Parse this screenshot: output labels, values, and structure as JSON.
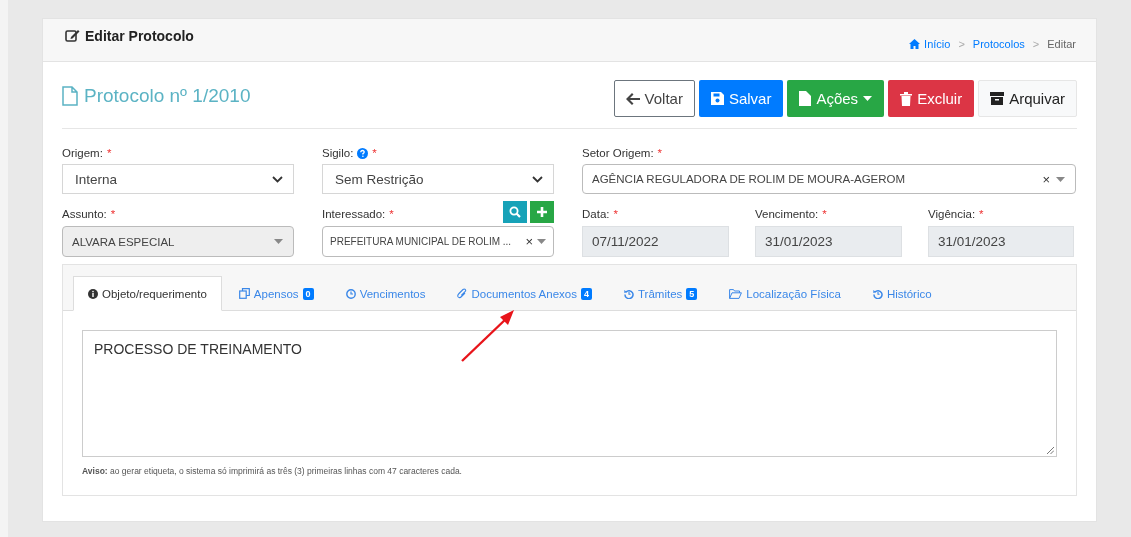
{
  "header": {
    "title": "Editar Protocolo",
    "breadcrumb_separator": ">",
    "breadcrumb": [
      {
        "label": "Início",
        "kind": "link"
      },
      {
        "label": "Protocolos",
        "kind": "link"
      },
      {
        "label": "Editar",
        "kind": "current"
      }
    ]
  },
  "protocol_title": "Protocolo nº 1/2010",
  "buttons": [
    {
      "label": "Voltar",
      "kind": "back"
    },
    {
      "label": "Salvar",
      "kind": "save"
    },
    {
      "label": "Ações",
      "kind": "actions"
    },
    {
      "label": "Excluir",
      "kind": "delete"
    },
    {
      "label": "Arquivar",
      "kind": "archive"
    }
  ],
  "row_1": [
    {
      "label": "Origem:",
      "required_mark": "*",
      "kind": "select",
      "value": "Interna",
      "disabled": false
    },
    {
      "label": "Sigilo:",
      "required_mark": "*",
      "kind": "select",
      "value": "Sem Restrição",
      "disabled": false,
      "help": true
    },
    {
      "label": "Setor Origem:",
      "required_mark": "*",
      "kind": "select2",
      "value": "AGÊNCIA REGULADORA DE ROLIM DE MOURA-AGEROM",
      "clear": "×",
      "disabled": false
    }
  ],
  "row_2": [
    {
      "label": "Assunto:",
      "required_mark": "*",
      "kind": "select2",
      "value": "ALVARA ESPECIAL",
      "disabled": true
    },
    {
      "label": "Interessado:",
      "required_mark": "*",
      "kind": "select2",
      "value": "PREFEITURA MUNICIPAL DE ROLIM ...",
      "clear": "×",
      "disabled": false,
      "tools": true
    },
    {
      "label": "Data:",
      "required_mark": "*",
      "kind": "text",
      "value": "07/11/2022",
      "disabled": true
    },
    {
      "label": "Vencimento:",
      "required_mark": "*",
      "kind": "text",
      "value": "31/01/2023",
      "disabled": true
    },
    {
      "label": "Vigência:",
      "required_mark": "*",
      "kind": "text",
      "value": "31/01/2023",
      "disabled": true
    }
  ],
  "tabs": [
    {
      "label": "Objeto/requerimento",
      "selected": true
    },
    {
      "label": "Apensos",
      "badge": "0",
      "selected": false
    },
    {
      "label": "Vencimentos",
      "selected": false
    },
    {
      "label": "Documentos Anexos",
      "badge": "4",
      "selected": false
    },
    {
      "label": "Trâmites",
      "badge": "5",
      "selected": false
    },
    {
      "label": "Localização Física",
      "selected": false
    },
    {
      "label": "Histórico",
      "selected": false
    }
  ],
  "textarea": {
    "value": "PROCESSO DE TREINAMENTO"
  },
  "notice": "**Aviso:** ao gerar etiqueta, o sistema só imprimirá as três (3) primeiras linhas com 47 caracteres cada."
}
